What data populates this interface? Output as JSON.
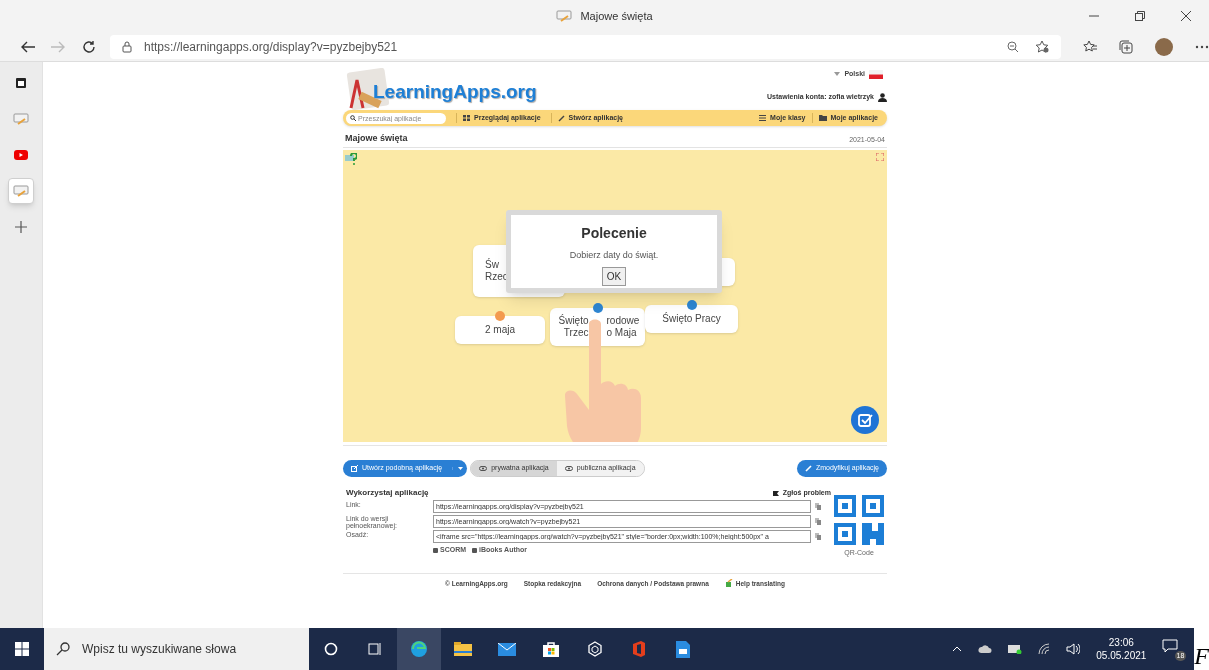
{
  "browser": {
    "tab_title": "Majowe święta",
    "url": "https://learningapps.org/display?v=pyzbejby521"
  },
  "sidebar": {
    "items": [
      {
        "kind": "calendar",
        "selected": false
      },
      {
        "kind": "app",
        "selected": false
      },
      {
        "kind": "video",
        "selected": false
      },
      {
        "kind": "app",
        "selected": true
      },
      {
        "kind": "add",
        "selected": false
      }
    ]
  },
  "site": {
    "logo": "LearningApps.org",
    "language": "Polski",
    "account": "Ustawienia konta: zofia wietrzyk",
    "search_placeholder": "Przeszukaj aplikacje",
    "nav_left": [
      "Przeglądaj aplikacje",
      "Stwórz aplikację"
    ],
    "nav_right": [
      "Moje klasy",
      "Moje aplikacje"
    ]
  },
  "app": {
    "title": "Majowe święta",
    "date": "2021-05-04",
    "cards": [
      {
        "lines": [
          [
            "Św"
          ],
          [
            "Rzec"
          ]
        ]
      },
      {
        "lines": [
          [
            "2 maja"
          ]
        ],
        "color": "#f39a4f"
      },
      {
        "lines": [
          [
            "Święto",
            "rodowe"
          ],
          [
            "Trzec",
            "o Maja"
          ]
        ],
        "color": "#2e86d1"
      },
      {
        "lines": [
          [
            "Święto Pracy"
          ]
        ],
        "color": "#2e86d1"
      }
    ],
    "dialog": {
      "title": "Polecenie",
      "text": "Dobierz daty do świąt.",
      "button": "OK"
    }
  },
  "actions": {
    "create_similar": "Utwórz podobną aplikację",
    "visibility": [
      {
        "label": "prywatna aplikacja",
        "selected": true
      },
      {
        "label": "publiczna aplikacja",
        "selected": false
      }
    ],
    "modify": "Zmodyfikuj aplikację"
  },
  "use": {
    "heading": "Wykorzystaj aplikację",
    "report": "Zgłoś problem",
    "fields": [
      {
        "label": "Link:",
        "value": "https://learningapps.org/display?v=pyzbejby521"
      },
      {
        "label": "Link do wersji pełnoekranowej:",
        "value": "https://learningapps.org/watch?v=pyzbejby521"
      },
      {
        "label": "Osadź:",
        "value": "<iframe src=\"https://learningapps.org/watch?v=pyzbejby521\" style=\"border:0px;width:100%;height:500px\" a"
      }
    ],
    "exports": [
      "SCORM",
      "iBooks Author"
    ],
    "qr_label": "QR-Code"
  },
  "footer": [
    "© LearningApps.org",
    "Stopka redakcyjna",
    "Ochrona danych / Podstawa prawna",
    "Help translating"
  ],
  "taskbar": {
    "search_placeholder": "Wpisz tu wyszukiwane słowa",
    "apps": [
      {
        "kind": "cortana",
        "selected": false
      },
      {
        "kind": "taskview",
        "selected": false
      },
      {
        "kind": "edge",
        "selected": true
      },
      {
        "kind": "explorer",
        "selected": false
      },
      {
        "kind": "mail",
        "selected": false
      },
      {
        "kind": "store",
        "selected": false
      },
      {
        "kind": "cube",
        "selected": false
      },
      {
        "kind": "office",
        "selected": false
      },
      {
        "kind": "docs",
        "selected": false
      }
    ],
    "time": "23:06",
    "date": "05.05.2021",
    "notifications": "18"
  },
  "edge_mark": "F"
}
